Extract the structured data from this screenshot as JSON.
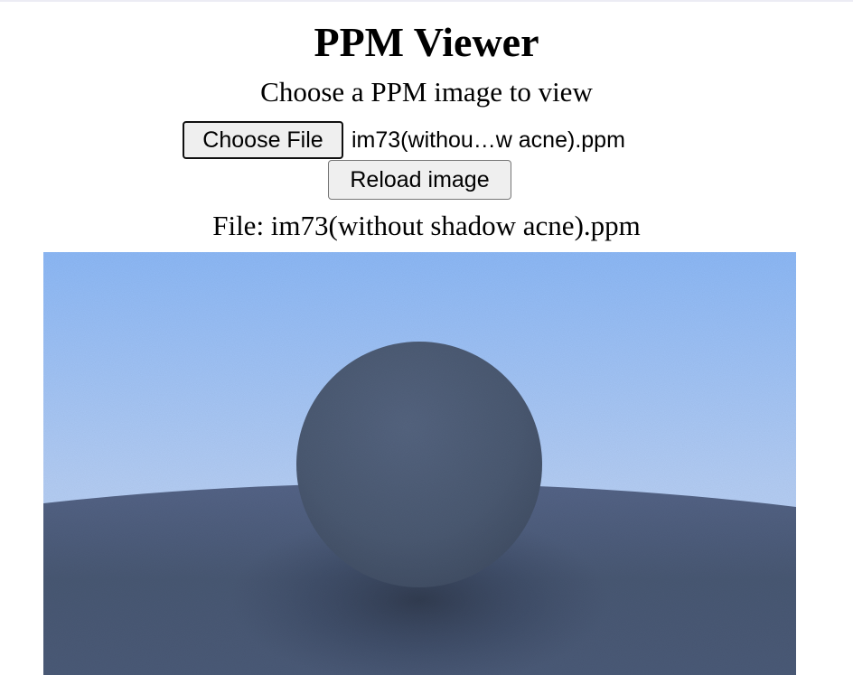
{
  "header": {
    "title": "PPM Viewer",
    "subtitle": "Choose a PPM image to view"
  },
  "file_input": {
    "button_label": "Choose File",
    "selected_file_display": "im73(withou…w acne).ppm"
  },
  "reload_button": {
    "label": "Reload image"
  },
  "file_info": {
    "label": "File: im73(without shadow acne).ppm"
  },
  "render": {
    "sky_top_color": "#8fbcfb",
    "sky_bottom_color": "#c9dcf8",
    "ground_color": "#4a5a76",
    "sphere_color": "#4c5b74"
  }
}
